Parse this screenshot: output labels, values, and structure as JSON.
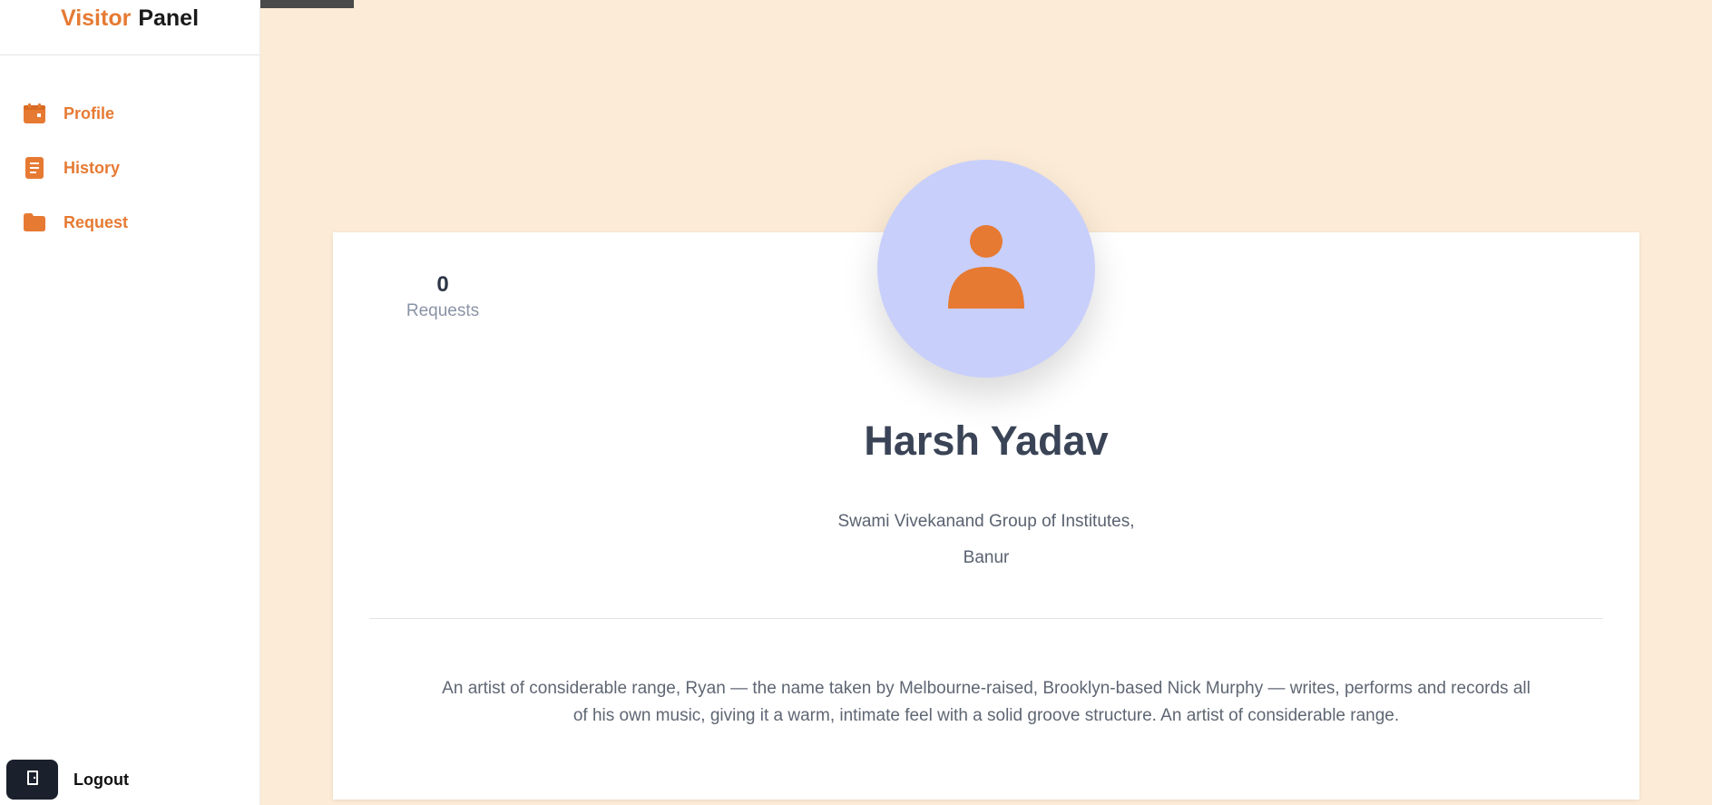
{
  "sidebar": {
    "brand_accent": "Visitor",
    "brand_plain": "Panel",
    "items": [
      {
        "label": "Profile",
        "icon": "calendar-icon"
      },
      {
        "label": "History",
        "icon": "document-icon"
      },
      {
        "label": "Request",
        "icon": "folder-icon"
      }
    ],
    "logout_label": "Logout"
  },
  "profile": {
    "requests_count": "0",
    "requests_label": "Requests",
    "name": "Harsh Yadav",
    "org_line1": "Swami Vivekanand Group of Institutes,",
    "org_line2": "Banur",
    "bio": "An artist of considerable range, Ryan — the name taken by Melbourne-raised, Brooklyn-based Nick Murphy — writes, performs and records all of his own music, giving it a warm, intimate feel with a solid groove structure. An artist of considerable range."
  },
  "colors": {
    "accent": "#e67a33",
    "background": "#fcebd6",
    "avatar_bg": "#c8cffb"
  }
}
